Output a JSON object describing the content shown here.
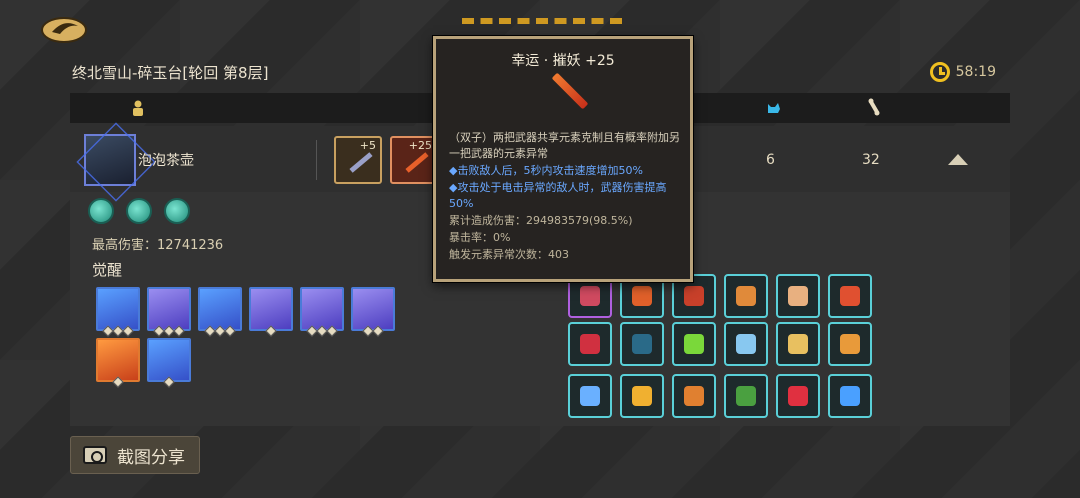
{
  "header": {
    "level_title": "终北雪山-碎玉台[轮回 第8层]",
    "timer": "58:19"
  },
  "player": {
    "name": "泡泡茶壶",
    "weapons": [
      {
        "plus": "+5"
      },
      {
        "plus": "+25"
      }
    ],
    "stat_a": "6",
    "stat_b": "32",
    "max_damage": "最高伤害：12741236",
    "awaken_label": "觉醒",
    "awakenings": [
      {
        "color": "blue",
        "pips": 3
      },
      {
        "color": "purple",
        "pips": 3
      },
      {
        "color": "blue",
        "pips": 3
      },
      {
        "color": "purple",
        "pips": 1
      },
      {
        "color": "purple",
        "pips": 3
      },
      {
        "color": "purple",
        "pips": 2
      },
      {
        "color": "orange",
        "pips": 1
      },
      {
        "color": "blue",
        "pips": 1
      }
    ]
  },
  "tooltip": {
    "title": "幸运 · 摧妖 +25",
    "line1": "（双子）两把武器共享元素克制且有概率附加另一把武器的元素异常",
    "line2": "◆击败敌人后，5秒内攻击速度增加50%",
    "line3": "◆攻击处于电击异常的敌人时，武器伤害提高50%",
    "line4": "累计造成伤害：294983579(98.5%)",
    "line5": "暴击率：0%",
    "line6": "触发元素异常次数：403"
  },
  "items": {
    "glyph_colors": [
      "#d04a60",
      "#e0602a",
      "#c8402a",
      "#e08a3a",
      "#e8b080",
      "#e05030",
      "#d03040",
      "#2a6a88",
      "#7ad83a",
      "#88c8f0",
      "#e8c060",
      "#e89a3a",
      "#6ab0ff",
      "#f0b030",
      "#e08030",
      "#4aa040",
      "#e03040",
      "#4aa0ff"
    ]
  },
  "share": {
    "label": "截图分享"
  },
  "colors": {
    "accent_gold": "#f0c020",
    "teal_border": "#5ad0d8"
  }
}
